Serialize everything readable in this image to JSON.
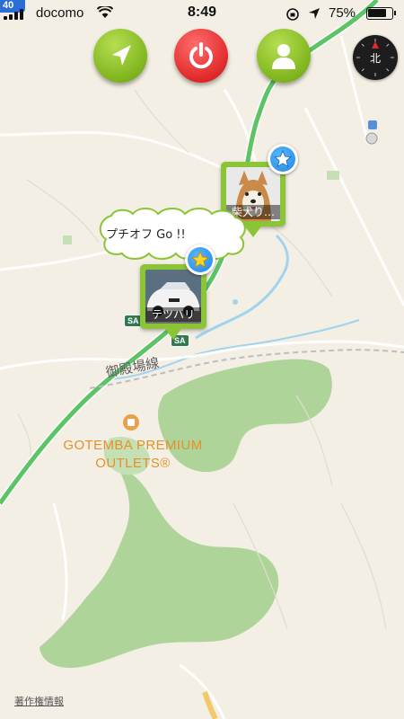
{
  "status_bar": {
    "carrier": "docomo",
    "time": "8:49",
    "battery_percent": "75%",
    "icons": [
      "signal-icon",
      "wifi-icon",
      "orientation-lock-icon",
      "location-arrow-icon",
      "battery-icon"
    ]
  },
  "toolbar": {
    "buttons": [
      {
        "name": "navigate-button",
        "icon": "navigation-arrow-icon",
        "color": "#8cc437"
      },
      {
        "name": "power-button",
        "icon": "power-icon",
        "color": "#e02929"
      },
      {
        "name": "profile-button",
        "icon": "person-icon",
        "color": "#8cc437"
      }
    ]
  },
  "compass": {
    "label": "北",
    "needle_color": "#e02929"
  },
  "map": {
    "route_badge": "40",
    "place_label": "GOTEMBA PREMIUM OUTLETS®",
    "place_label_lines": [
      "GOTEMBA PREMIUM",
      "OUTLETS®"
    ],
    "rail_label": "御殿場線",
    "sa_labels": [
      "SA",
      "SA"
    ],
    "road_color": "#5cc466",
    "park_color": "#aed49a",
    "water_color": "#9fd3ee",
    "copyright": "著作権情報"
  },
  "pins": [
    {
      "label": "柴犬り…",
      "photo": "shiba-dog-photo",
      "starred": true
    },
    {
      "label": "テツハリ",
      "photo": "white-car-photo",
      "starred": true
    }
  ],
  "bubble": {
    "text": "プチオフ Go !!"
  }
}
